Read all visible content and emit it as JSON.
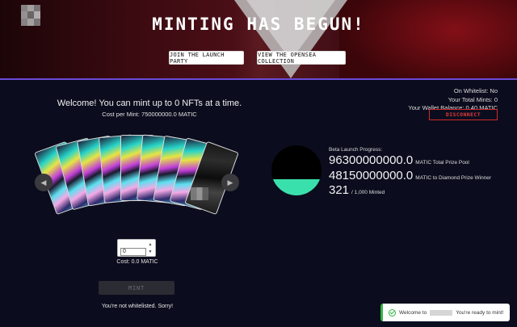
{
  "header": {
    "title": "MINTING HAS BEGUN!",
    "join_button": "JOIN THE LAUNCH PARTY",
    "opensea_button": "VIEW THE OPENSEA COLLECTION"
  },
  "wallet": {
    "on_whitelist": "On Whitelist: No",
    "total_mints": "Your Total Mints: 0",
    "balance": "Your Wallet Balance: 0.40 MATIC",
    "disconnect_label": "DISCONNECT"
  },
  "mint": {
    "welcome": "Welcome! You can mint up to 0 NFTs at a time.",
    "cost_per_mint": "Cost per Mint: 750000000.0 MATIC",
    "quantity_value": "0",
    "quantity_cost": "Cost: 0.0 MATIC",
    "mint_button": "MINT",
    "status_message": "You're not whitelisted. Sorry!"
  },
  "progress": {
    "label": "Beta Launch Progress:",
    "prize_pool_value": "96300000000.0",
    "prize_pool_label": "MATIC Total Prize Pool",
    "diamond_value": "48150000000.0",
    "diamond_label": "MATIC to Diamond Prize Winner",
    "minted_value": "321",
    "minted_total": "/ 1,000 Minted",
    "fill_fraction": 0.321
  },
  "toast": {
    "prefix": "Welcome to",
    "suffix": "You're ready to mint!"
  },
  "colors": {
    "accent": "#6b4bd8",
    "progress_fill": "#3ae0ac",
    "danger": "#d02a2a",
    "success": "#2fb344"
  }
}
